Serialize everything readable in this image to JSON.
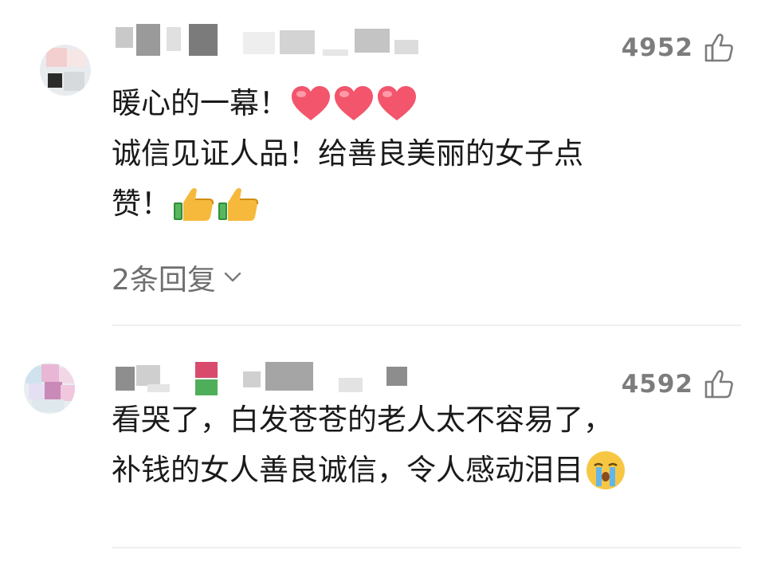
{
  "comments": [
    {
      "like_count": "4952",
      "lines": [
        "暖心的一幕！",
        "诚信见证人品！给善良美丽的女子点",
        "赞！"
      ],
      "emojis": [
        "heart",
        "heart",
        "heart",
        "thumbs-up",
        "thumbs-up"
      ],
      "reply_label": "2条回复"
    },
    {
      "like_count": "4592",
      "lines": [
        "看哭了，白发苍苍的老人太不容易了，",
        "补钱的女人善良诚信，令人感动泪目"
      ],
      "emojis": [
        "crying-face"
      ]
    }
  ],
  "colors": {
    "text": "#1a1a1a",
    "muted": "#7c7c7c",
    "heart": "#f2556c",
    "thumb": "#f6b93b",
    "divider": "#efefef"
  },
  "icons": [
    "thumbs-up-outline-icon",
    "chevron-down-icon",
    "heart-emoji",
    "thumbs-up-emoji",
    "crying-face-emoji"
  ]
}
